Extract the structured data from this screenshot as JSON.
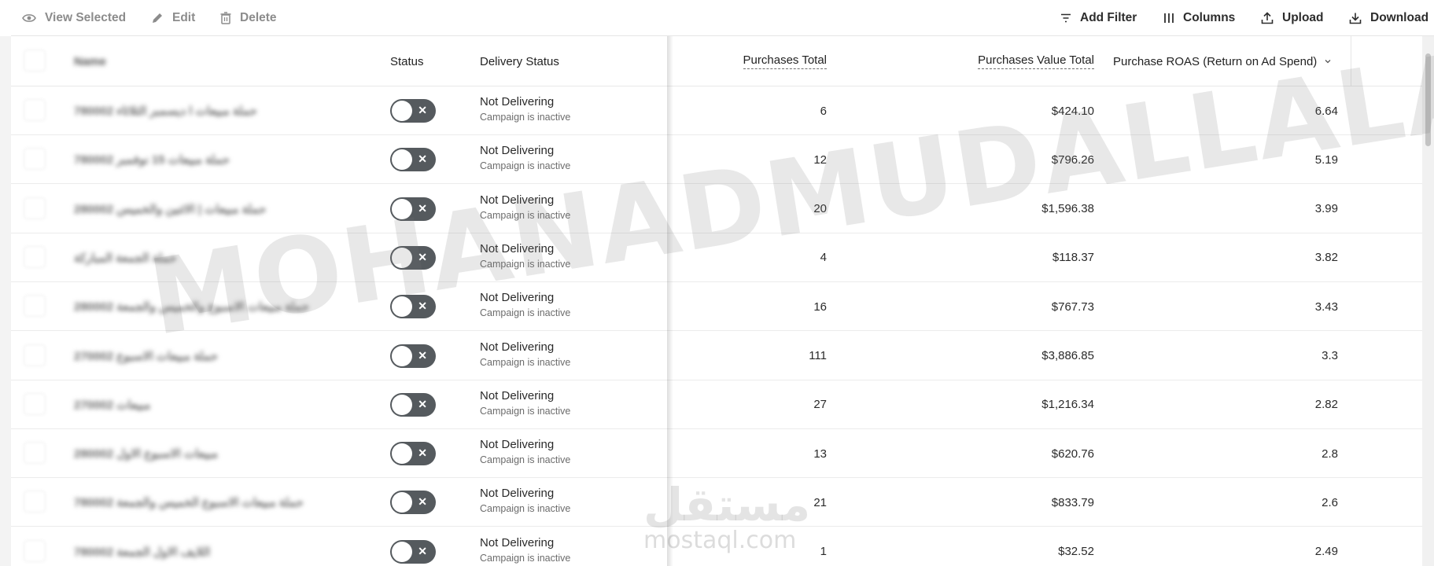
{
  "toolbar": {
    "view_selected": "View Selected",
    "edit": "Edit",
    "delete": "Delete",
    "add_filter": "Add Filter",
    "columns": "Columns",
    "upload": "Upload",
    "download": "Download"
  },
  "table": {
    "headers": {
      "name": "Name",
      "status": "Status",
      "delivery": "Delivery Status",
      "purchases_total": "Purchases Total",
      "purchases_value_total": "Purchases Value Total",
      "purchase_roas": "Purchase ROAS (Return on Ad Spend)"
    },
    "rows": [
      {
        "name": "حملة مبيعات ا ديسمبر الثلاثاء 780002",
        "status_on": false,
        "delivery": "Not Delivering",
        "delivery_sub": "Campaign is inactive",
        "purchases": "6",
        "value": "$424.10",
        "roas": "6.64"
      },
      {
        "name": "حملة مبيعات 15 نوفمبر 780002",
        "status_on": false,
        "delivery": "Not Delivering",
        "delivery_sub": "Campaign is inactive",
        "purchases": "12",
        "value": "$796.26",
        "roas": "5.19"
      },
      {
        "name": "حملة مبيعات | الاثنين والخميس 280002",
        "status_on": false,
        "delivery": "Not Delivering",
        "delivery_sub": "Campaign is inactive",
        "purchases": "20",
        "value": "$1,596.38",
        "roas": "3.99"
      },
      {
        "name": "حملة الجمعة المباركة",
        "status_on": false,
        "delivery": "Not Delivering",
        "delivery_sub": "Campaign is inactive",
        "purchases": "4",
        "value": "$118.37",
        "roas": "3.82"
      },
      {
        "name": "حملة مبيعات الاسبوع والخميس والجمعة 280002",
        "status_on": false,
        "delivery": "Not Delivering",
        "delivery_sub": "Campaign is inactive",
        "purchases": "16",
        "value": "$767.73",
        "roas": "3.43"
      },
      {
        "name": "حملة مبيعات الاسبوع 270002",
        "status_on": false,
        "delivery": "Not Delivering",
        "delivery_sub": "Campaign is inactive",
        "purchases": "111",
        "value": "$3,886.85",
        "roas": "3.3"
      },
      {
        "name": "مبيعات 270002",
        "status_on": false,
        "delivery": "Not Delivering",
        "delivery_sub": "Campaign is inactive",
        "purchases": "27",
        "value": "$1,216.34",
        "roas": "2.82"
      },
      {
        "name": "مبيعات الاسبوع الاول 280002",
        "status_on": false,
        "delivery": "Not Delivering",
        "delivery_sub": "Campaign is inactive",
        "purchases": "13",
        "value": "$620.76",
        "roas": "2.8"
      },
      {
        "name": "حملة مبيعات الاسبوع الخميس والجمعة 780002",
        "status_on": false,
        "delivery": "Not Delivering",
        "delivery_sub": "Campaign is inactive",
        "purchases": "21",
        "value": "$833.79",
        "roas": "2.6"
      },
      {
        "name": "اللايف الاول الجمعة 780002",
        "status_on": false,
        "delivery": "Not Delivering",
        "delivery_sub": "Campaign is inactive",
        "purchases": "1",
        "value": "$32.52",
        "roas": "2.49"
      }
    ]
  },
  "watermark": {
    "text": "MOHANADMUDALLALA",
    "logo_ar": "مستقل",
    "logo_en": "mostaql.com"
  },
  "colors": {
    "toggle_off": "#555a5e",
    "border": "#e8e8e8",
    "text": "#222222"
  }
}
